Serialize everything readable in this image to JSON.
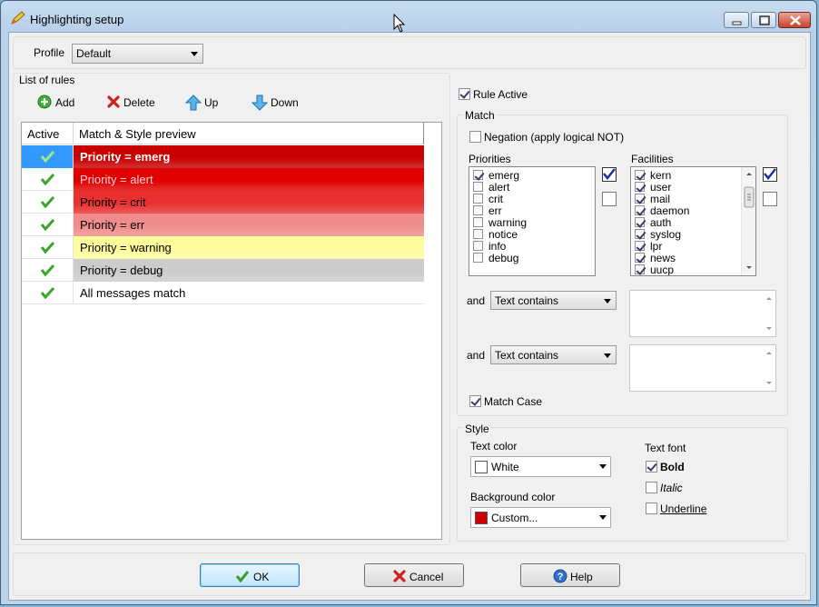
{
  "window": {
    "title": "Highlighting setup"
  },
  "profile": {
    "label": "Profile",
    "value": "Default"
  },
  "rules": {
    "group_label": "List of rules",
    "toolbar": {
      "add": "Add",
      "delete": "Delete",
      "up": "Up",
      "down": "Down"
    },
    "columns": {
      "active": "Active",
      "preview": "Match & Style preview"
    },
    "rows": [
      {
        "text": "Priority = emerg",
        "bg": "#c80000",
        "fg": "#ffffff",
        "bold": true,
        "selected": true
      },
      {
        "text": "Priority = alert",
        "bg": "#e00000",
        "fg": "#ffd6d6",
        "bold": false
      },
      {
        "text": "Priority = crit",
        "bg": "#e83030",
        "fg": "#000000",
        "bold": false
      },
      {
        "text": "Priority = err",
        "bg": "#f08c8c",
        "fg": "#000000",
        "bold": false
      },
      {
        "text": "Priority = warning",
        "bg": "#fdfd9c",
        "fg": "#000000",
        "bold": false
      },
      {
        "text": "Priority = debug",
        "bg": "#cccccc",
        "fg": "#000000",
        "bold": false
      },
      {
        "text": "All messages match",
        "bg": "#ffffff",
        "fg": "#000000",
        "bold": false
      }
    ]
  },
  "rule_active": {
    "label": "Rule Active",
    "checked": true
  },
  "match": {
    "group_label": "Match",
    "negation": {
      "label": "Negation (apply logical NOT)",
      "checked": false
    },
    "priorities": {
      "label": "Priorities",
      "items": [
        {
          "label": "emerg",
          "checked": true
        },
        {
          "label": "alert",
          "checked": false
        },
        {
          "label": "crit",
          "checked": false
        },
        {
          "label": "err",
          "checked": false
        },
        {
          "label": "warning",
          "checked": false
        },
        {
          "label": "notice",
          "checked": false
        },
        {
          "label": "info",
          "checked": false
        },
        {
          "label": "debug",
          "checked": false
        }
      ]
    },
    "facilities": {
      "label": "Facilities",
      "items": [
        {
          "label": "kern",
          "checked": true
        },
        {
          "label": "user",
          "checked": true
        },
        {
          "label": "mail",
          "checked": true
        },
        {
          "label": "daemon",
          "checked": true
        },
        {
          "label": "auth",
          "checked": true
        },
        {
          "label": "syslog",
          "checked": true
        },
        {
          "label": "lpr",
          "checked": true
        },
        {
          "label": "news",
          "checked": true
        },
        {
          "label": "uucp",
          "checked": true
        }
      ]
    },
    "conditions": [
      {
        "and_label": "and",
        "operator": "Text contains",
        "value": ""
      },
      {
        "and_label": "and",
        "operator": "Text contains",
        "value": ""
      }
    ],
    "match_case": {
      "label": "Match Case",
      "checked": true
    }
  },
  "style": {
    "group_label": "Style",
    "text_color": {
      "label": "Text color",
      "value": "White",
      "swatch": "#ffffff"
    },
    "background_color": {
      "label": "Background color",
      "value": "Custom...",
      "swatch": "#cc0000"
    },
    "text_font": {
      "label": "Text font",
      "bold": {
        "label": "Bold",
        "checked": true
      },
      "italic": {
        "label": "Italic",
        "checked": false
      },
      "underline": {
        "label": "Underline",
        "checked": false
      }
    }
  },
  "buttons": {
    "ok": "OK",
    "cancel": "Cancel",
    "help": "Help"
  }
}
